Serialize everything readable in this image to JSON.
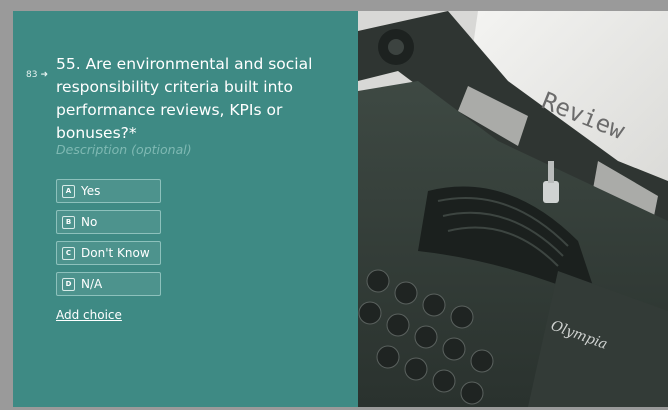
{
  "question": {
    "number_marker": "83",
    "text": "55. Are environmental and social responsibility criteria built into performance reviews, KPIs or bonuses?*",
    "description_placeholder": "Description (optional)"
  },
  "choices": [
    {
      "key": "A",
      "label": "Yes"
    },
    {
      "key": "B",
      "label": "No"
    },
    {
      "key": "C",
      "label": "Don't Know"
    },
    {
      "key": "D",
      "label": "N/A"
    }
  ],
  "add_choice_label": "Add choice",
  "image": {
    "paper_text": "Review",
    "brand_text": "Olympia"
  },
  "colors": {
    "panel": "#3e8a84",
    "border": "#9a9a9a"
  }
}
